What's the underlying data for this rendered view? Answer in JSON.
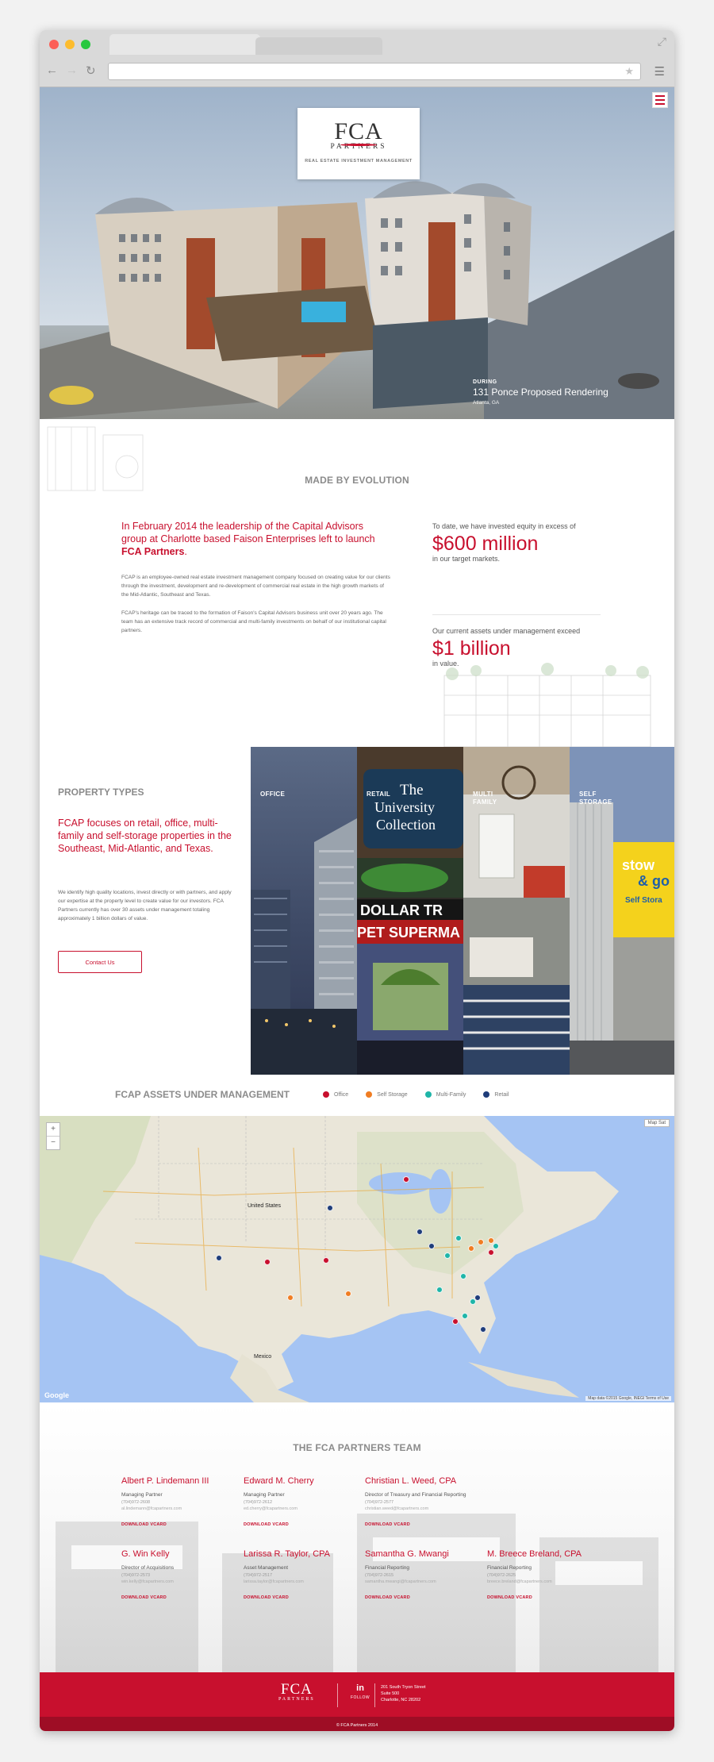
{
  "hero": {
    "logo": {
      "name": "FCA",
      "sub": "PARTNERS",
      "tagline": "REAL ESTATE INVESTMENT MANAGEMENT"
    },
    "caption": {
      "label": "DURING",
      "title": "131 Ponce Proposed Rendering",
      "location": "Atlanta, GA"
    }
  },
  "evolution": {
    "title": "MADE BY EVOLUTION",
    "lead": "In February 2014 the leadership of the Capital Advisors group at Charlotte based Faison Enterprises left to launch",
    "lead_strong": "FCA Partners",
    "lead_end": ".",
    "para1": "FCAP is an employee-owned real estate investment management company focused on creating value for our clients through the investment, development and re-development of commercial real estate in the high growth markets of the Mid-Atlantic, Southeast and Texas.",
    "para2": "FCAP's heritage can be traced to the formation of Faison's Capital Advisors business unit over 20 years ago. The team has an extensive track record of commercial and multi-family investments on behalf of our institutional capital partners.",
    "stats": [
      {
        "pre": "To date, we have invested equity in excess of",
        "value": "$600 million",
        "post": "in our target markets."
      },
      {
        "pre": "Our current assets under management exceed",
        "value": "$1 billion",
        "post": "in value."
      }
    ]
  },
  "property_types": {
    "title": "PROPERTY TYPES",
    "lead": "FCAP focuses on retail, office, multi-family and self-storage properties in the Southeast, Mid-Atlantic, and Texas.",
    "body": "We identify high quality locations, invest directly or with partners, and apply our expertise at the property level to create value for our investors. FCA Partners currently has over 30 assets under management totaling approximately 1 billion dollars of value.",
    "button": "Contact Us",
    "panels": [
      {
        "label": "OFFICE",
        "label2": ""
      },
      {
        "label": "RETAIL",
        "label2": ""
      },
      {
        "label": "MULTI",
        "label2": "FAMILY"
      },
      {
        "label": "SELF",
        "label2": "STORAGE"
      }
    ],
    "signs": {
      "sign1": "The",
      "sign2": "University",
      "sign3": "Collection",
      "sign4": "DOLLAR TR",
      "sign5": "PET SUPERMA",
      "sign6": "stow",
      "sign7": "& go",
      "sign8": "Self Stora"
    }
  },
  "map": {
    "title": "FCAP ASSETS UNDER MANAGEMENT",
    "legend": [
      {
        "label": "Office",
        "color": "#c8102e"
      },
      {
        "label": "Self Storage",
        "color": "#f07d23"
      },
      {
        "label": "Multi-Family",
        "color": "#1fb5a8"
      },
      {
        "label": "Retail",
        "color": "#1f3d7a"
      }
    ],
    "labels": {
      "us": "United States",
      "mexico": "Mexico"
    },
    "controls": {
      "zoom_in": "+",
      "zoom_out": "−",
      "map_type": "Map  Sat"
    },
    "credit": "Map data ©2015 Google, INEGI   Terms of Use",
    "google": "Google"
  },
  "team": {
    "title": "THE FCA PARTNERS TEAM",
    "download_label": "DOWNLOAD VCARD",
    "members": [
      {
        "name": "Albert P. Lindemann III",
        "role": "Managing Partner",
        "phone": "(704)972-2608",
        "email": "al.lindemann@fcapartners.com"
      },
      {
        "name": "Edward M. Cherry",
        "role": "Managing Partner",
        "phone": "(704)972-2612",
        "email": "ed.cherry@fcapartners.com"
      },
      {
        "name": "Christian L. Weed, CPA",
        "role": "Director of Treasury and Financial Reporting",
        "phone": "(704)972-2577",
        "email": "christian.weed@fcapartners.com"
      },
      {
        "name": "G. Win Kelly",
        "role": "Director of Acquisitions",
        "phone": "(704)972-2573",
        "email": "win.kelly@fcapartners.com"
      },
      {
        "name": "Larissa R. Taylor, CPA",
        "role": "Asset Management",
        "phone": "(704)972-2517",
        "email": "larissa.taylor@fcapartners.com"
      },
      {
        "name": "Samantha G. Mwangi",
        "role": "Financial Reporting",
        "phone": "(704)972-2615",
        "email": "samantha.mwangi@fcapartners.com"
      },
      {
        "name": "M. Breece Breland, CPA",
        "role": "Financial Reporting",
        "phone": "(704)972-2625",
        "email": "breece.breland@fcapartners.com"
      }
    ]
  },
  "footer": {
    "logo": "FCA",
    "logo_sub": "PARTNERS",
    "linkedin": "in",
    "follow": "FOLLOW",
    "address": [
      "201 South Tryon Street",
      "Suite 500",
      "Charlotte, NC 28202"
    ],
    "copyright": "© FCA Partners 2014"
  },
  "colors": {
    "brand_red": "#c8102e",
    "footer_dark": "#9e0d25",
    "map_water": "#a5c4f3"
  }
}
